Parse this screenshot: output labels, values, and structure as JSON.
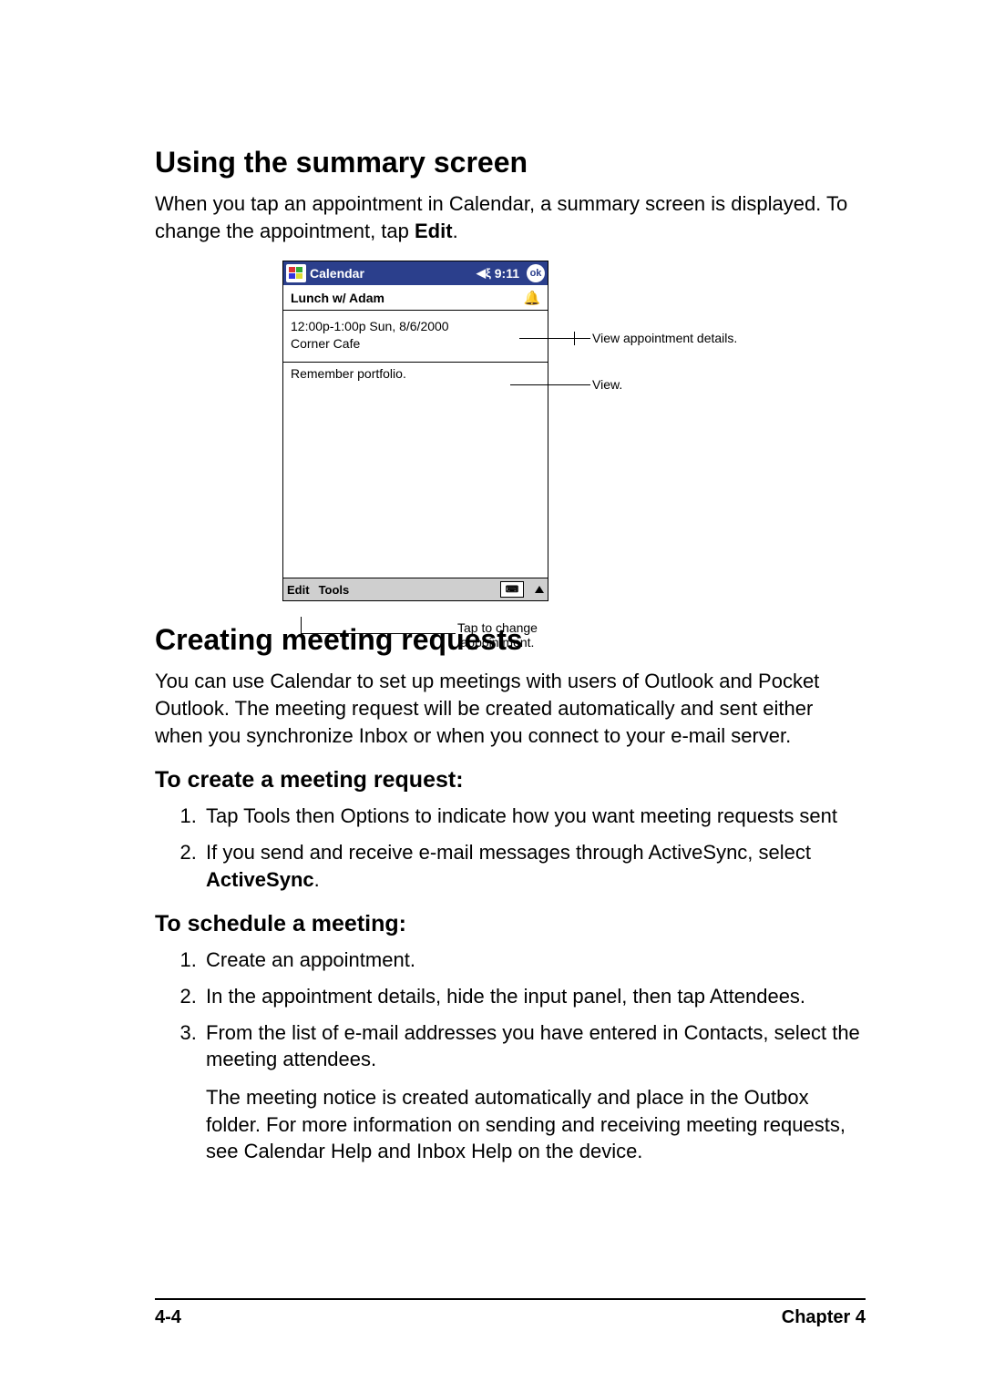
{
  "section1": {
    "heading": "Using the summary screen",
    "intro_part1": "When you tap an appointment in Calendar, a summary screen is displayed. To change the appointment, tap ",
    "intro_bold": "Edit",
    "intro_part2": "."
  },
  "device": {
    "app_title": "Calendar",
    "time": "9:11",
    "ok": "ok",
    "subject": "Lunch w/ Adam",
    "detail_line1": "12:00p-1:00p Sun, 8/6/2000",
    "detail_line2": "Corner Cafe",
    "note": "Remember portfolio.",
    "menu_edit": "Edit",
    "menu_tools": "Tools"
  },
  "callouts": {
    "details": "View appointment details.",
    "notes": "View.",
    "edit_line1": "Tap to change",
    "edit_line2": "appointment."
  },
  "section2": {
    "heading": "Creating meeting requests",
    "intro": "You can use Calendar to set up meetings with users of Outlook and Pocket Outlook. The meeting request will be created automatically and sent either when you synchronize Inbox or when you connect to your e-mail server."
  },
  "sub1": {
    "heading": "To create a meeting request:",
    "step1": "Tap Tools then Options to indicate how you want meeting requests sent",
    "step2_part1": "If you send and receive e-mail messages through ActiveSync, select ",
    "step2_bold": "ActiveSync",
    "step2_part2": "."
  },
  "sub2": {
    "heading": "To schedule a meeting:",
    "step1": "Create an appointment.",
    "step2": "In the appointment details, hide the input panel, then tap Attendees.",
    "step3": "From the list of e-mail addresses you have entered in Contacts, select the meeting attendees.",
    "step3_extra": "The meeting notice is created automatically and place in the Outbox folder. For more information on sending and receiving meeting requests, see Calendar Help and Inbox Help on the device."
  },
  "footer": {
    "page": "4-4",
    "chapter": "Chapter 4"
  }
}
